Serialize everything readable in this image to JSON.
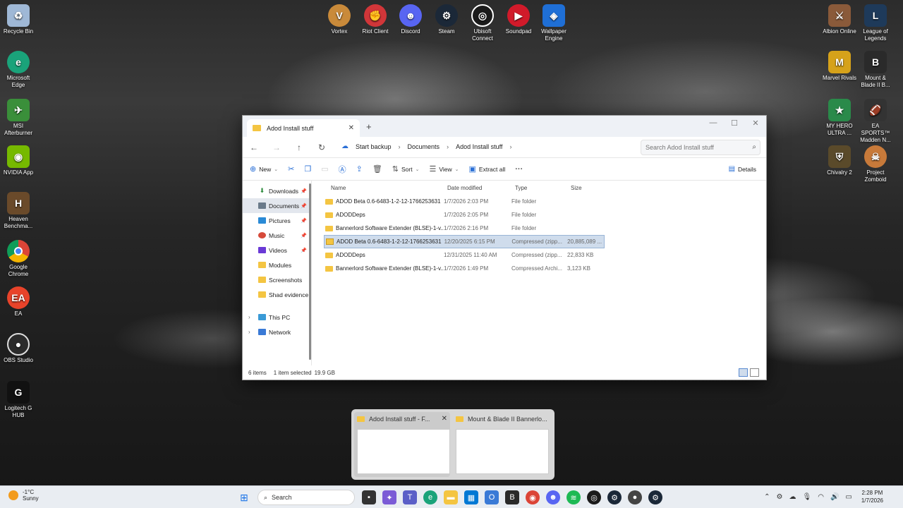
{
  "desktop": {
    "left_icons": [
      {
        "label": "Recycle Bin",
        "icon": "recycle-bin-icon",
        "color": "#9fb8d6"
      },
      {
        "label": "Microsoft Edge",
        "icon": "edge-icon",
        "color": "#1aa37a"
      },
      {
        "label": "MSI Afterburner",
        "icon": "afterburner-icon",
        "color": "#3a8f3a"
      },
      {
        "label": "NVIDIA App",
        "icon": "nvidia-icon",
        "color": "#76b900"
      },
      {
        "label": "Heaven Benchma...",
        "icon": "heaven-icon",
        "color": "#6a4a2a"
      },
      {
        "label": "Google Chrome",
        "icon": "chrome-icon",
        "color": "#db4437"
      },
      {
        "label": "EA",
        "icon": "ea-icon",
        "color": "#e8432a"
      },
      {
        "label": "OBS Studio",
        "icon": "obs-icon",
        "color": "#2b2b2b"
      },
      {
        "label": "Logitech G HUB",
        "icon": "logitech-icon",
        "color": "#111111"
      }
    ],
    "top_icons": [
      {
        "label": "Vortex",
        "icon": "vortex-icon",
        "color": "#c98a3a"
      },
      {
        "label": "Riot Client",
        "icon": "riot-icon",
        "color": "#d13639"
      },
      {
        "label": "Discord",
        "icon": "discord-icon",
        "color": "#5865f2"
      },
      {
        "label": "Steam",
        "icon": "steam-icon",
        "color": "#1b2838"
      },
      {
        "label": "Ubisoft Connect",
        "icon": "ubisoft-icon",
        "color": "#1b1b1b"
      },
      {
        "label": "Soundpad",
        "icon": "soundpad-icon",
        "color": "#d11a2a"
      },
      {
        "label": "Wallpaper Engine",
        "icon": "wallpaper-engine-icon",
        "color": "#1f6fd6"
      }
    ],
    "right_icons": [
      {
        "label": "Albion Online",
        "icon": "albion-icon",
        "color": "#8a5a3a"
      },
      {
        "label": "League of Legends",
        "icon": "league-icon",
        "color": "#1e3a5a"
      },
      {
        "label": "Marvel Rivals",
        "icon": "marvel-rivals-icon",
        "color": "#d6a21a"
      },
      {
        "label": "Mount & Blade II B...",
        "icon": "bannerlord-icon",
        "color": "#2a2a2a"
      },
      {
        "label": "MY HERO ULTRA ...",
        "icon": "my-hero-icon",
        "color": "#2a8a4a"
      },
      {
        "label": "EA SPORTS™ Madden N...",
        "icon": "madden-icon",
        "color": "#333333"
      },
      {
        "label": "Chivalry 2",
        "icon": "chivalry-icon",
        "color": "#5a4a2a"
      },
      {
        "label": "Project Zomboid",
        "icon": "zomboid-icon",
        "color": "#c87a3a"
      }
    ]
  },
  "explorer": {
    "tab_title": "Adod Install stuff",
    "breadcrumb": [
      "Start backup",
      "Documents",
      "Adod Install stuff"
    ],
    "search_placeholder": "Search Adod Install stuff",
    "toolbar": {
      "new": "New",
      "sort": "Sort",
      "view": "View",
      "extract_all": "Extract all",
      "details": "Details"
    },
    "nav": [
      {
        "label": "Downloads",
        "pinned": true,
        "color": "#2a8a3a"
      },
      {
        "label": "Documents",
        "pinned": true,
        "color": "#6a7a8a",
        "selected": true
      },
      {
        "label": "Pictures",
        "pinned": true,
        "color": "#2a8ad6"
      },
      {
        "label": "Music",
        "pinned": true,
        "color": "#d64a3a"
      },
      {
        "label": "Videos",
        "pinned": true,
        "color": "#6a3ad6"
      },
      {
        "label": "Modules",
        "pinned": false,
        "color": "#f4c542"
      },
      {
        "label": "Screenshots",
        "pinned": false,
        "color": "#f4c542"
      },
      {
        "label": "Shad evidence",
        "pinned": false,
        "color": "#f4c542"
      }
    ],
    "nav_groups": [
      "This PC",
      "Network"
    ],
    "columns": [
      "Name",
      "Date modified",
      "Type",
      "Size"
    ],
    "files": [
      {
        "name": "ADOD Beta 0.6-6483-1-2-12-1766253631",
        "date": "1/7/2026 2:03 PM",
        "type": "File folder",
        "size": "",
        "kind": "folder"
      },
      {
        "name": "ADODDeps",
        "date": "1/7/2026 2:05 PM",
        "type": "File folder",
        "size": "",
        "kind": "folder"
      },
      {
        "name": "Bannerlord Software Extender (BLSE)-1-v...",
        "date": "1/7/2026 2:16 PM",
        "type": "File folder",
        "size": "",
        "kind": "folder"
      },
      {
        "name": "ADOD Beta 0.6-6483-1-2-12-1766253631",
        "date": "12/20/2025 6:15 PM",
        "type": "Compressed (zipp...",
        "size": "20,885,089 ...",
        "kind": "zip",
        "selected": true
      },
      {
        "name": "ADODDeps",
        "date": "12/31/2025 11:40 AM",
        "type": "Compressed (zipp...",
        "size": "22,833 KB",
        "kind": "zip"
      },
      {
        "name": "Bannerlord Software Extender (BLSE)-1-v...",
        "date": "1/7/2026 1:49 PM",
        "type": "Compressed Archi...",
        "size": "3,123 KB",
        "kind": "zip"
      }
    ],
    "status": {
      "count": "6 items",
      "selection": "1 item selected",
      "size": "19.9 GB"
    }
  },
  "thumbnails": [
    {
      "title": "Adod Install stuff - F...",
      "active": true
    },
    {
      "title": "Mount & Blade II Bannerlo...",
      "active": false
    }
  ],
  "taskbar": {
    "weather_temp": "-1°C",
    "weather_desc": "Sunny",
    "search_label": "Search",
    "time": "2:28 PM",
    "date": "1/7/2026"
  }
}
